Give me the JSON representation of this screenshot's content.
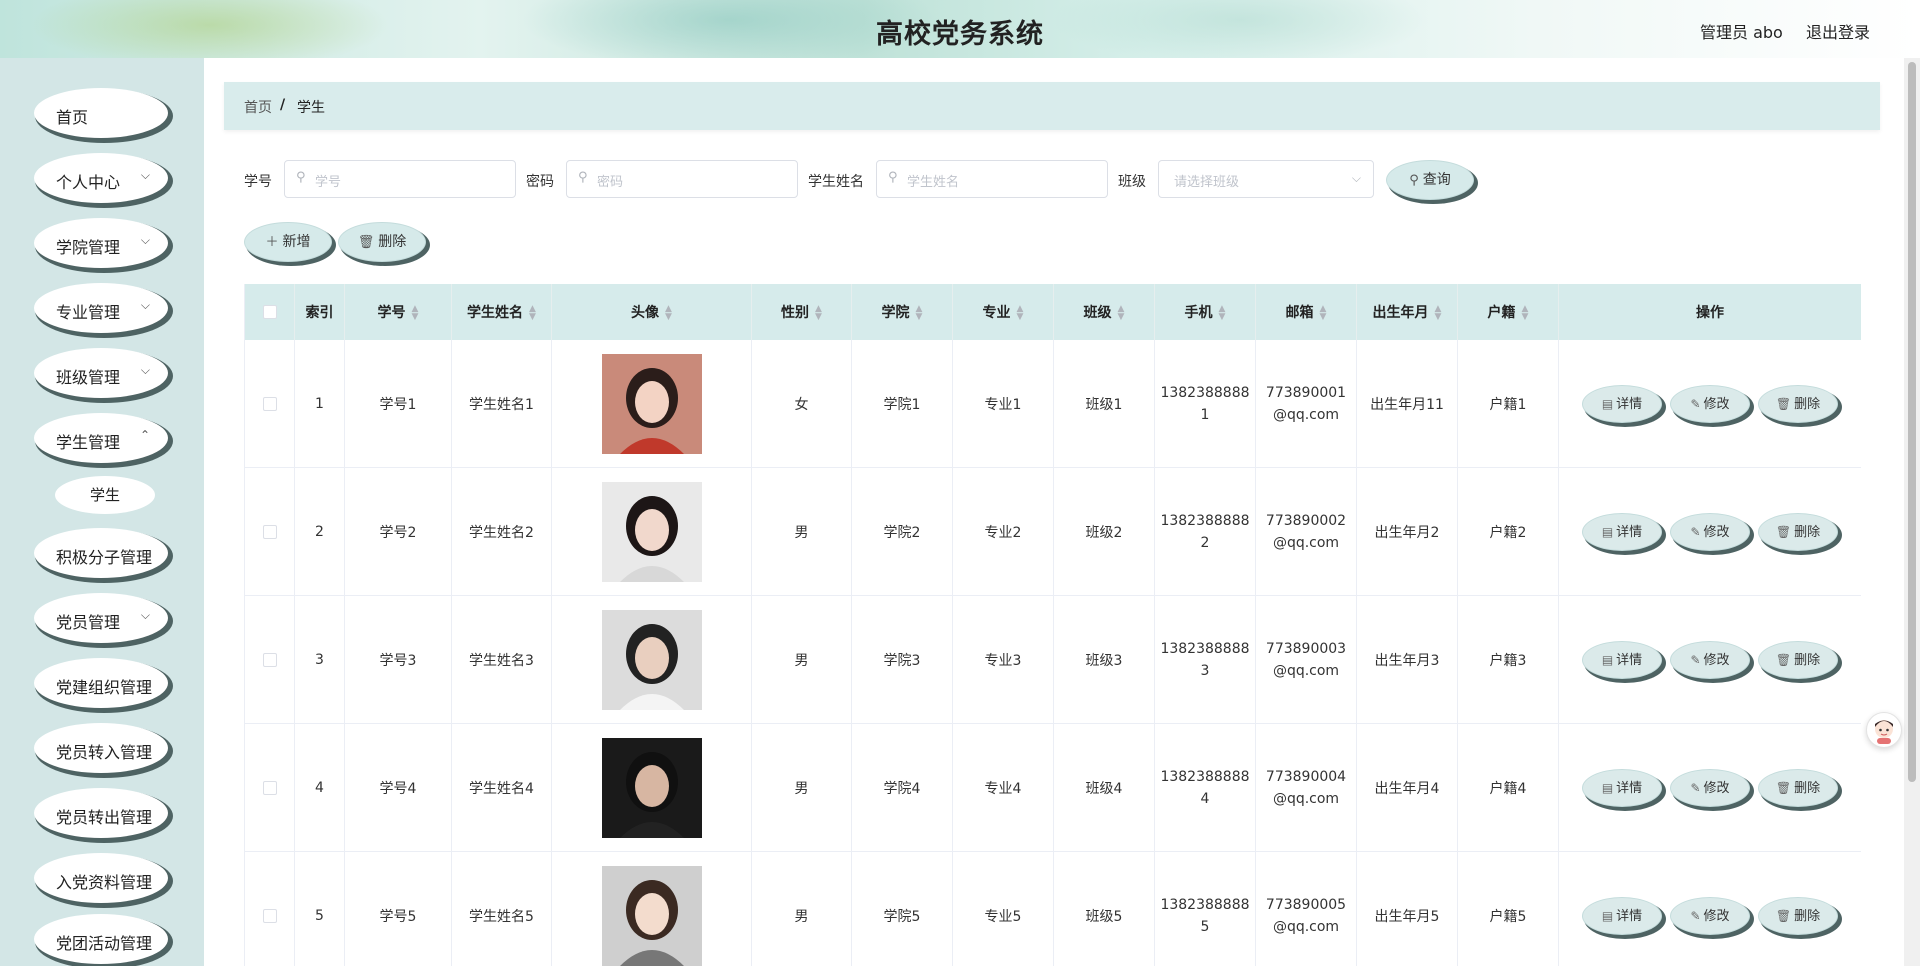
{
  "header": {
    "title": "高校党务系统",
    "user": "管理员 abo",
    "logout": "退出登录"
  },
  "sidebar": {
    "items": [
      {
        "label": "首页",
        "has_children": false
      },
      {
        "label": "个人中心",
        "has_children": true
      },
      {
        "label": "学院管理",
        "has_children": true
      },
      {
        "label": "专业管理",
        "has_children": true
      },
      {
        "label": "班级管理",
        "has_children": true
      },
      {
        "label": "学生管理",
        "has_children": true
      },
      {
        "label": "积极分子管理",
        "has_children": true
      },
      {
        "label": "党员管理",
        "has_children": true
      },
      {
        "label": "党建组织管理",
        "has_children": true
      },
      {
        "label": "党员转入管理",
        "has_children": true
      },
      {
        "label": "党员转出管理",
        "has_children": true
      },
      {
        "label": "入党资料管理",
        "has_children": true
      },
      {
        "label": "党团活动管理",
        "has_children": true
      }
    ],
    "active_submenu": "学生"
  },
  "breadcrumb": {
    "home": "首页",
    "separator": "/",
    "current": "学生"
  },
  "filters": {
    "student_no_label": "学号",
    "student_no_placeholder": "学号",
    "password_label": "密码",
    "password_placeholder": "密码",
    "name_label": "学生姓名",
    "name_placeholder": "学生姓名",
    "class_label": "班级",
    "class_placeholder": "请选择班级",
    "search_button": "查询"
  },
  "toolbar": {
    "add_button": "新增",
    "delete_button": "删除"
  },
  "table": {
    "columns": [
      "索引",
      "学号",
      "学生姓名",
      "头像",
      "性别",
      "学院",
      "专业",
      "班级",
      "手机",
      "邮箱",
      "出生年月",
      "户籍",
      "操作"
    ],
    "rows": [
      {
        "index": "1",
        "student_no": "学号1",
        "name": "学生姓名1",
        "gender": "女",
        "college": "学院1",
        "major": "专业1",
        "class": "班级1",
        "phone": "13823888881",
        "email": "773890001@qq.com",
        "birth": "出生年月11",
        "hukou": "户籍1"
      },
      {
        "index": "2",
        "student_no": "学号2",
        "name": "学生姓名2",
        "gender": "男",
        "college": "学院2",
        "major": "专业2",
        "class": "班级2",
        "phone": "13823888882",
        "email": "773890002@qq.com",
        "birth": "出生年月2",
        "hukou": "户籍2"
      },
      {
        "index": "3",
        "student_no": "学号3",
        "name": "学生姓名3",
        "gender": "男",
        "college": "学院3",
        "major": "专业3",
        "class": "班级3",
        "phone": "13823888883",
        "email": "773890003@qq.com",
        "birth": "出生年月3",
        "hukou": "户籍3"
      },
      {
        "index": "4",
        "student_no": "学号4",
        "name": "学生姓名4",
        "gender": "男",
        "college": "学院4",
        "major": "专业4",
        "class": "班级4",
        "phone": "13823888884",
        "email": "773890004@qq.com",
        "birth": "出生年月4",
        "hukou": "户籍4"
      },
      {
        "index": "5",
        "student_no": "学号5",
        "name": "学生姓名5",
        "gender": "男",
        "college": "学院5",
        "major": "专业5",
        "class": "班级5",
        "phone": "13823888885",
        "email": "773890005@qq.com",
        "birth": "出生年月5",
        "hukou": "户籍5"
      }
    ],
    "actions": {
      "detail": "详情",
      "edit": "修改",
      "delete": "删除"
    }
  },
  "colors": {
    "accent": "#d6ebeb",
    "sidebar_bg": "#d3e6e6",
    "button_shadow": "#4e6363"
  }
}
